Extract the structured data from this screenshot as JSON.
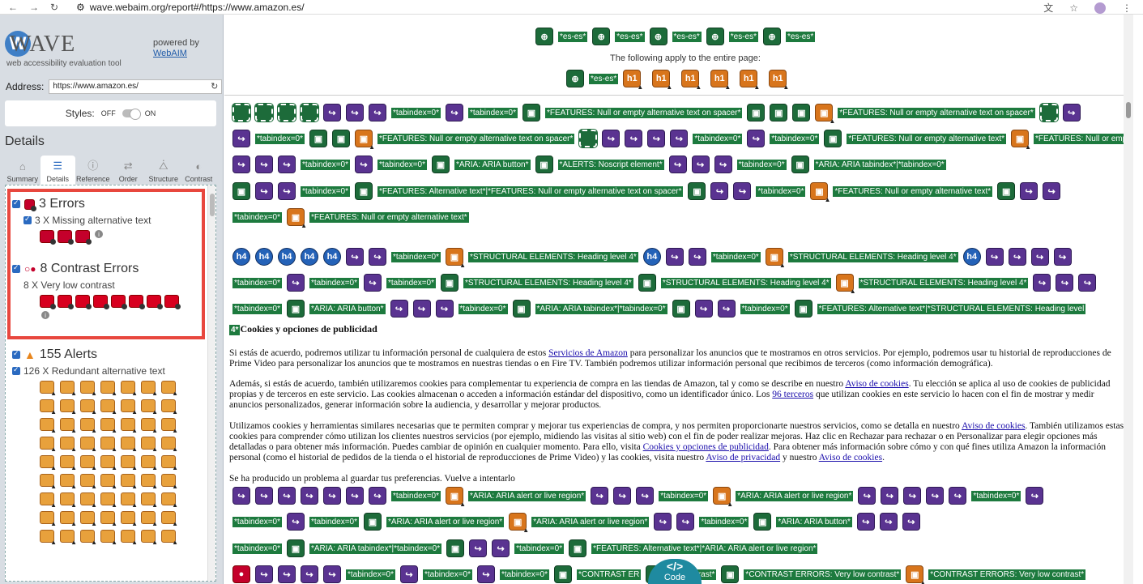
{
  "browser": {
    "url": "wave.webaim.org/report#/https://www.amazon.es/"
  },
  "sidebar": {
    "logo": "WAVE",
    "tagline": "web accessibility evaluation tool",
    "powered_by": "powered by",
    "powered_link": "WebAIM",
    "address_label": "Address:",
    "address_value": "https://www.amazon.es/",
    "styles_label": "Styles:",
    "styles_off": "OFF",
    "styles_on": "ON",
    "details_heading": "Details",
    "tabs": [
      {
        "label": "Summary"
      },
      {
        "label": "Details"
      },
      {
        "label": "Reference"
      },
      {
        "label": "Order"
      },
      {
        "label": "Structure"
      },
      {
        "label": "Contrast"
      }
    ],
    "errors": {
      "title": "3 Errors",
      "item": "3 X Missing alternative text"
    },
    "contrast": {
      "title": "8 Contrast Errors",
      "item": "8 X Very low contrast"
    },
    "alerts": {
      "title": "155 Alerts",
      "item": "126 X Redundant alternative text"
    }
  },
  "main": {
    "top_labels": [
      "*es-es*",
      "*es-es*",
      "*es-es*",
      "*es-es*",
      "*es-es*"
    ],
    "applies": "The following apply to the entire page:",
    "page_lang": "*es-es*",
    "h1": "h1",
    "h4": "h4",
    "l_tab": "*tabindex=0*",
    "l_spacer": "*FEATURES: Null or empty alternative text on spacer*",
    "l_null_alt": "*FEATURES: Null or empty alternative text*",
    "l_aria_button": "*ARIA: ARIA button*",
    "l_noscript": "*ALERTS: Noscript element*",
    "l_aria_tabindex": "*ARIA: ARIA tabindex*|*tabindex=0*",
    "l_alt_text_spacer": "*FEATURES: Alternative text*|*FEATURES: Null or empty alternative text on spacer*",
    "l_h4": "*STRUCTURAL ELEMENTS: Heading level 4*",
    "l_alt_h4": "*FEATURES: Alternative text*|*STRUCTURAL ELEMENTS: Heading level",
    "l_alert": "*ARIA: ARIA alert or live region*",
    "l_aria_tab_short": "*ARIA: ARIA tabindex*|*tabindex=0*",
    "l_alt_alert": "*FEATURES: Alternative text*|*ARIA: ARIA alert or live region*",
    "l_contrast": "*CONTRAST ERRORS: Very low contrast*",
    "l_contrast_cut": "*CONTRAST ER",
    "l_contrast_cut2": "ow contrast*",
    "l_4": "4*",
    "cookie_heading": "Cookies y opciones de publicidad",
    "p1a": "Si estás de acuerdo, podremos utilizar tu información personal de cualquiera de estos",
    "p1link": "Servicios de Amazon",
    "p1b": "para personalizar los anuncios que te mostramos en otros servicios. Por ejemplo, podremos usar tu historial de reproducciones de Prime Video para personalizar los anuncios que te mostramos en nuestras tiendas o en Fire TV. También podremos utilizar información personal que recibimos de terceros (como información demográfica).",
    "p2a": "Además, si estás de acuerdo, también utilizaremos cookies para complementar tu experiencia de compra en las tiendas de Amazon, tal y como se describe en nuestro",
    "p2link1": "Aviso de cookies",
    "p2b": ". Tu elección se aplica al uso de cookies de publicidad propias y de terceros en este servicio. Las cookies almacenan o acceden a información estándar del dispositivo, como un identificador único. Los",
    "p2link2": "96 terceros",
    "p2c": "que utilizan cookies en este servicio lo hacen con el fin de mostrar y medir anuncios personalizados, generar información sobre la audiencia, y desarrollar y mejorar productos.",
    "p3a": "Utilizamos cookies y herramientas similares necesarias que te permiten comprar y mejorar tus experiencias de compra, y nos permiten proporcionarte nuestros servicios, como se detalla en nuestro",
    "p3link1": "Aviso de cookies",
    "p3b": ". También utilizamos estas cookies para comprender cómo utilizan los clientes nuestros servicios (por ejemplo, midiendo las visitas al sitio web) con el fin de poder realizar mejoras. Haz clic en Rechazar para rechazar o en Personalizar para elegir opciones más detalladas o para obtener más información. Puedes cambiar de opinión en cualquier momento. Para ello, visita",
    "p3link2": "Cookies y opciones de publicidad",
    "p3c": ". Para obtener más información sobre cómo y con qué fines utiliza Amazon la información personal (como el historial de pedidos de la tienda o el historial de reproducciones de Prime Video) y las cookies, visita nuestro",
    "p3link3": "Aviso de privacidad",
    "p3d": "y nuestro",
    "p3link4": "Aviso de cookies",
    "p3e": ".",
    "p4": "Se ha producido un problema al guardar tus preferencias. Vuelve a intentarlo",
    "code_label": "Code"
  }
}
